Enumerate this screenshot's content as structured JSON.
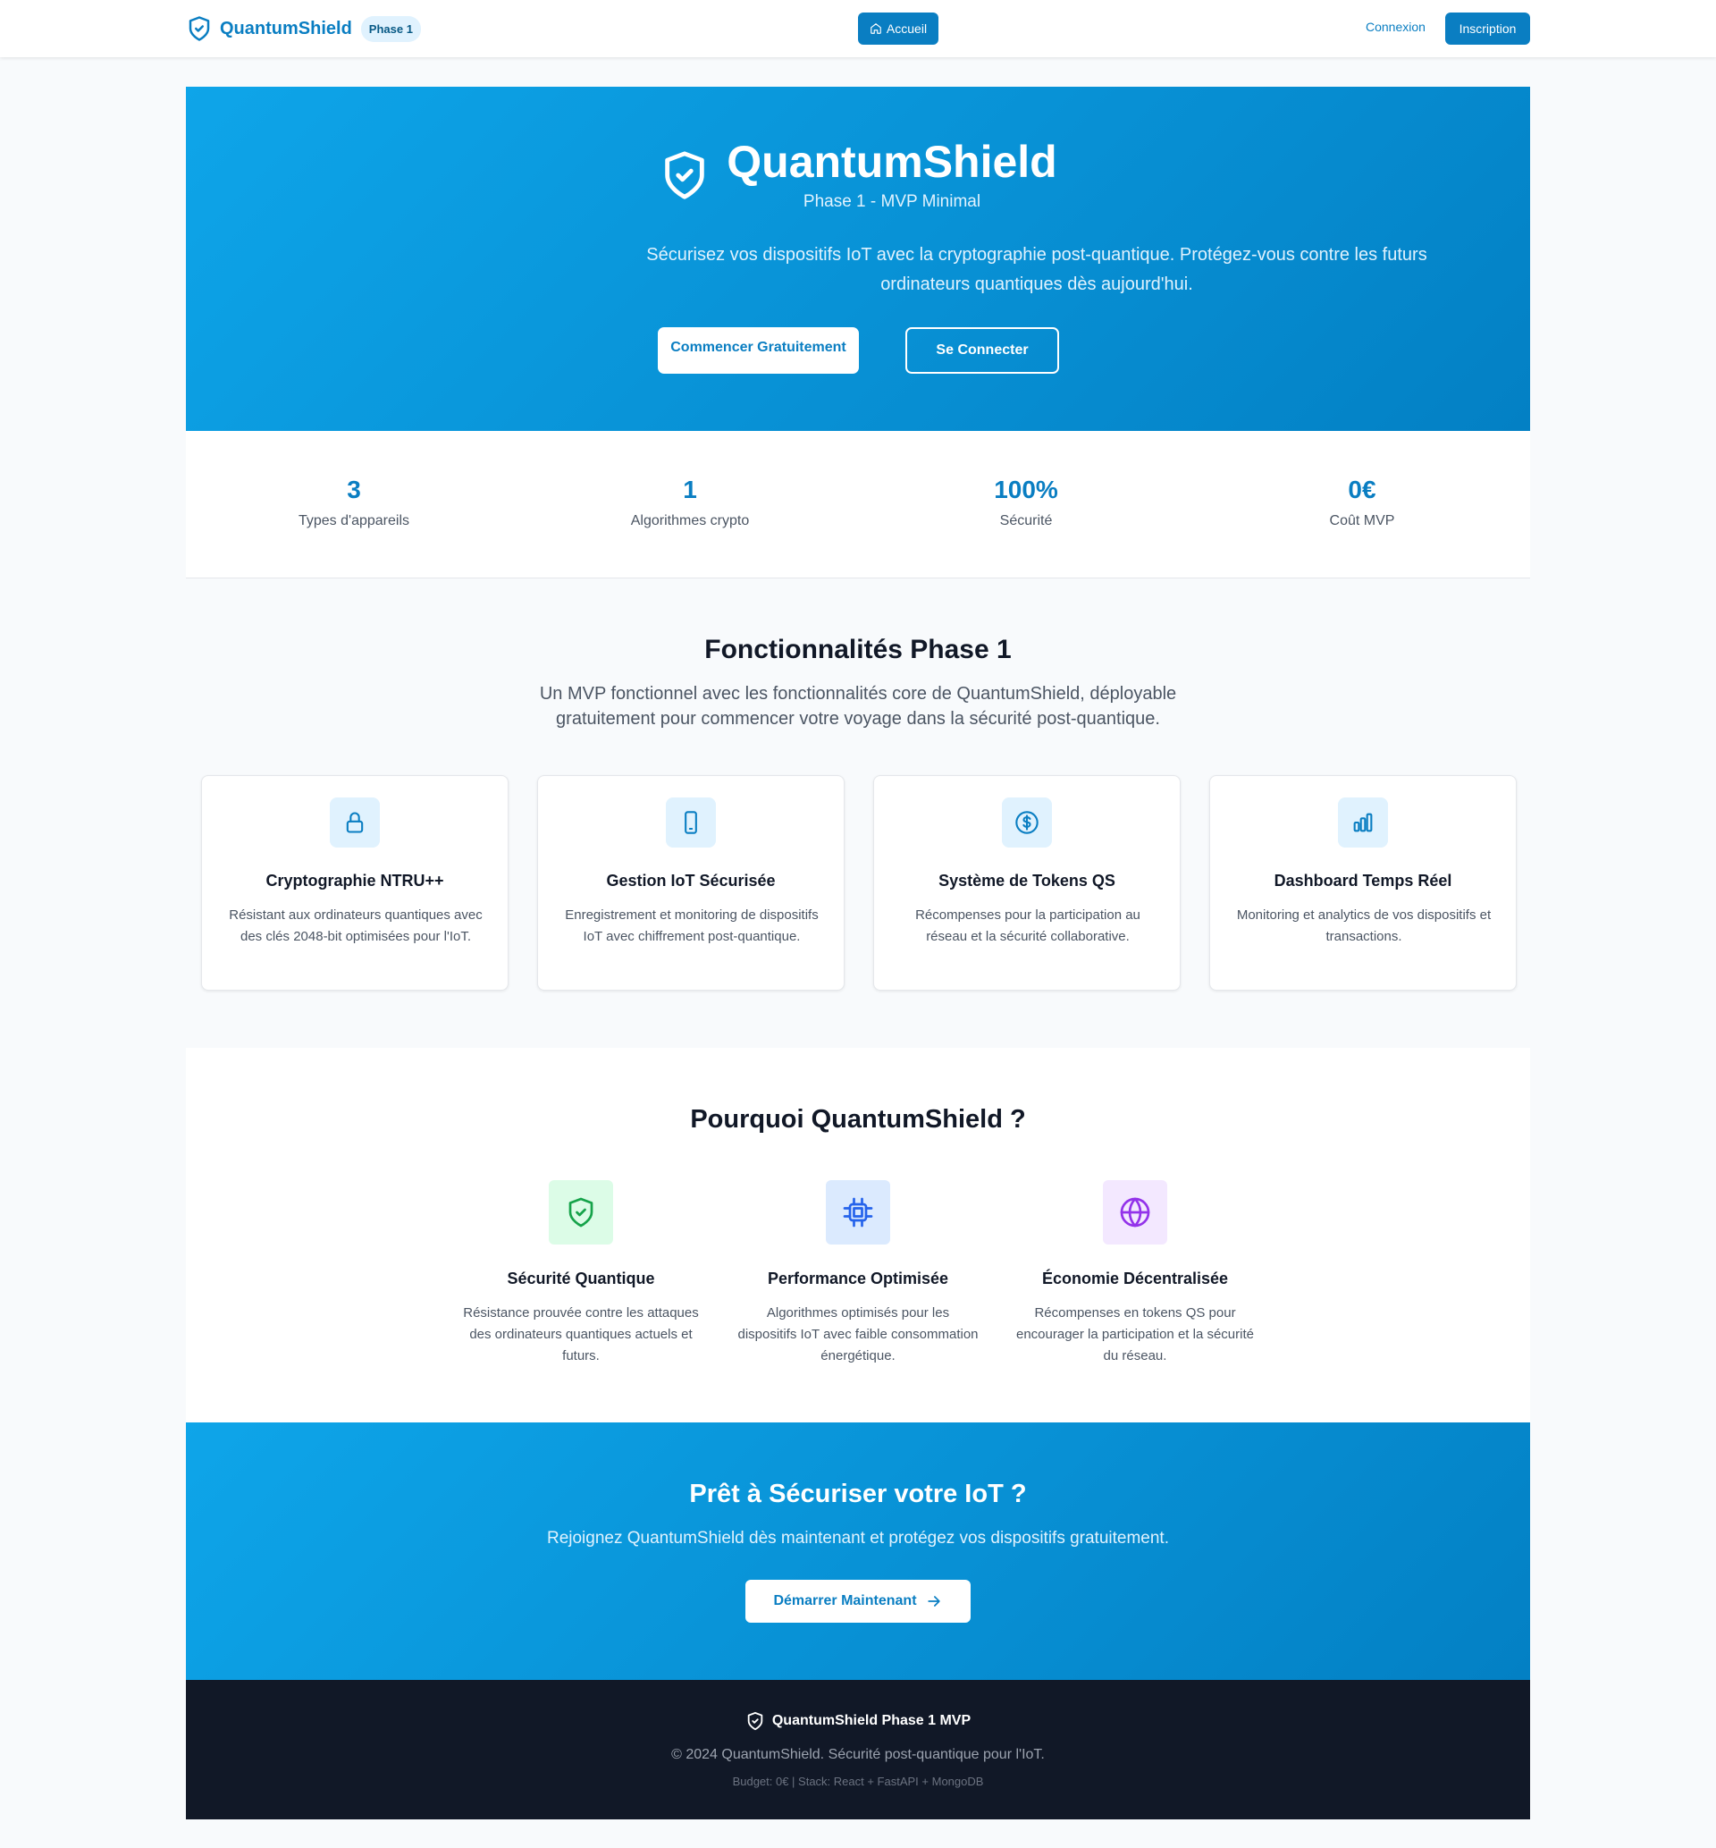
{
  "header": {
    "brand": "QuantumShield",
    "badge": "Phase 1",
    "nav_home": "Accueil",
    "login": "Connexion",
    "signup": "Inscription"
  },
  "hero": {
    "title": "QuantumShield",
    "subtitle": "Phase 1 - MVP Minimal",
    "description": "Sécurisez vos dispositifs IoT avec la cryptographie post-quantique. Protégez-vous contre les futurs ordinateurs quantiques dès aujourd'hui.",
    "primary_button": "Commencer Gratuitement",
    "secondary_button": "Se Connecter"
  },
  "stats": [
    {
      "value": "3",
      "label": "Types d'appareils"
    },
    {
      "value": "1",
      "label": "Algorithmes crypto"
    },
    {
      "value": "100%",
      "label": "Sécurité"
    },
    {
      "value": "0€",
      "label": "Coût MVP"
    }
  ],
  "features": {
    "title": "Fonctionnalités Phase 1",
    "subtitle": "Un MVP fonctionnel avec les fonctionnalités core de QuantumShield, déployable gratuitement pour commencer votre voyage dans la sécurité post-quantique.",
    "cards": [
      {
        "icon": "lock-icon",
        "title": "Cryptographie NTRU++",
        "description": "Résistant aux ordinateurs quantiques avec des clés 2048-bit optimisées pour l'IoT."
      },
      {
        "icon": "smartphone-icon",
        "title": "Gestion IoT Sécurisée",
        "description": "Enregistrement et monitoring de dispositifs IoT avec chiffrement post-quantique."
      },
      {
        "icon": "dollar-circle-icon",
        "title": "Système de Tokens QS",
        "description": "Récompenses pour la participation au réseau et la sécurité collaborative."
      },
      {
        "icon": "bar-chart-icon",
        "title": "Dashboard Temps Réel",
        "description": "Monitoring et analytics de vos dispositifs et transactions."
      }
    ]
  },
  "why": {
    "title": "Pourquoi QuantumShield ?",
    "items": [
      {
        "icon": "shield-check-icon",
        "color": "#16a34a",
        "bg": "#dcfce7",
        "title": "Sécurité Quantique",
        "description": "Résistance prouvée contre les attaques des ordinateurs quantiques actuels et futurs."
      },
      {
        "icon": "cpu-icon",
        "color": "#2563eb",
        "bg": "#dbeafe",
        "title": "Performance Optimisée",
        "description": "Algorithmes optimisés pour les dispositifs IoT avec faible consommation énergétique."
      },
      {
        "icon": "globe-icon",
        "color": "#9333ea",
        "bg": "#f3e8ff",
        "title": "Économie Décentralisée",
        "description": "Récompenses en tokens QS pour encourager la participation et la sécurité du réseau."
      }
    ]
  },
  "cta": {
    "title": "Prêt à Sécuriser votre IoT ?",
    "subtitle": "Rejoignez QuantumShield dès maintenant et protégez vos dispositifs gratuitement.",
    "button": "Démarrer Maintenant"
  },
  "footer": {
    "brand": "QuantumShield Phase 1 MVP",
    "copyright": "© 2024 QuantumShield. Sécurité post-quantique pour l'IoT.",
    "stack": "Budget: 0€ | Stack: React + FastAPI + MongoDB"
  },
  "colors": {
    "primary": "#0a7ec2",
    "hero_gradient_start": "#0ea5e9",
    "hero_gradient_end": "#0380c4",
    "footer_bg": "#111827"
  }
}
